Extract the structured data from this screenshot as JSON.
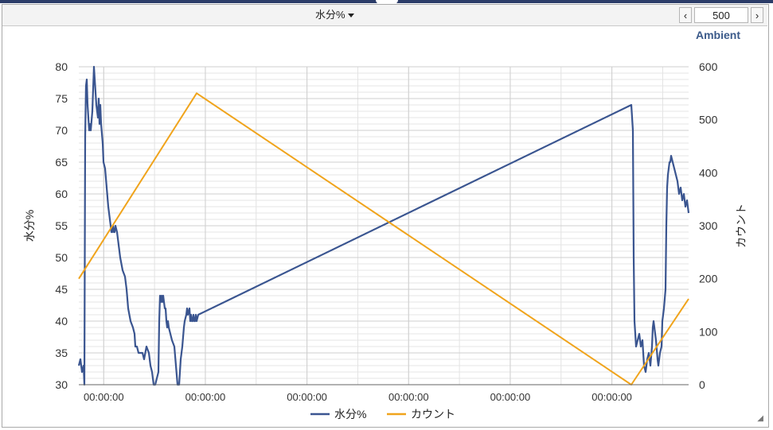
{
  "toolbar": {
    "field_label": "水分%",
    "page_size": "500",
    "prev_icon": "chevron-left-icon",
    "next_icon": "chevron-right-icon"
  },
  "chart_data": {
    "type": "line",
    "title": "Ambient",
    "x_tick_labels": [
      "00:00:00",
      "00:00:00",
      "00:00:00",
      "00:00:00",
      "00:00:00",
      "00:00:00"
    ],
    "y_left": {
      "label": "水分%",
      "range": [
        30,
        80
      ],
      "ticks": [
        30,
        35,
        40,
        45,
        50,
        55,
        60,
        65,
        70,
        75,
        80
      ]
    },
    "y_right": {
      "label": "カウント",
      "range": [
        0,
        600
      ],
      "ticks": [
        0,
        100,
        200,
        300,
        400,
        500,
        600
      ]
    },
    "grid": true,
    "legend_position": "bottom",
    "series": [
      {
        "name": "水分%",
        "axis": "left",
        "color": "#3a5590",
        "x": [
          0,
          2,
          4,
          6,
          7,
          8,
          9,
          10,
          11,
          12,
          13,
          14,
          15,
          17,
          19,
          20,
          21,
          22,
          23,
          24,
          25,
          26,
          27,
          28,
          30,
          31,
          33,
          35,
          37,
          39,
          40,
          41,
          42,
          43,
          44,
          45,
          46,
          48,
          50,
          52,
          55,
          58,
          60,
          62,
          65,
          68,
          70,
          71,
          73,
          75,
          77,
          80,
          82,
          85,
          88,
          90,
          92,
          94,
          96,
          98,
          100,
          101,
          102,
          103,
          104,
          105,
          106,
          107,
          108,
          109,
          110,
          111,
          112,
          113,
          115,
          117,
          120,
          122,
          124,
          126,
          128,
          130,
          132,
          133,
          135,
          136,
          137,
          139,
          140,
          141,
          142,
          143,
          144,
          145,
          146,
          147,
          148,
          150,
          694,
          696,
          697,
          698,
          700,
          702,
          704,
          706,
          708,
          710,
          712,
          714,
          716,
          718,
          720,
          721,
          722,
          723,
          725,
          727,
          728,
          730,
          732,
          733,
          735,
          737,
          738,
          739,
          740,
          741,
          742,
          743,
          744,
          746,
          748,
          750,
          752,
          754,
          756,
          758,
          760,
          762,
          764,
          766
        ],
        "y": [
          33,
          34,
          32,
          33,
          30,
          69,
          77,
          78,
          74,
          72,
          70,
          71,
          70,
          73,
          80,
          78,
          76,
          74,
          73,
          72,
          75,
          71,
          74,
          71,
          68,
          65,
          64,
          61,
          58,
          56,
          55,
          54,
          54,
          55,
          54,
          54,
          55,
          54,
          52,
          50,
          48,
          47,
          45,
          42,
          40,
          39,
          38,
          36,
          36,
          35,
          35,
          35,
          34,
          36,
          35,
          33,
          32,
          30,
          30,
          31,
          32,
          40,
          44,
          43,
          44,
          43,
          44,
          43,
          42,
          42,
          40,
          39,
          40,
          39,
          38,
          37,
          36,
          33,
          30,
          30,
          34,
          36,
          39,
          40,
          41,
          42,
          41,
          42,
          40,
          41,
          40,
          40,
          41,
          40,
          40,
          41,
          40,
          41,
          74,
          70,
          50,
          40,
          36,
          37,
          38,
          36,
          37,
          33,
          32,
          34,
          35,
          33,
          36,
          39,
          40,
          39,
          37,
          34,
          33,
          35,
          36,
          40,
          42,
          45,
          55,
          61,
          63,
          64,
          65,
          65,
          66,
          65,
          64,
          63,
          62,
          60,
          61,
          59,
          60,
          58,
          59,
          57
        ]
      },
      {
        "name": "カウント",
        "axis": "right",
        "color": "#f0a41c",
        "x": [
          0,
          148,
          694,
          766
        ],
        "y": [
          200,
          550,
          0,
          162
        ]
      }
    ]
  }
}
